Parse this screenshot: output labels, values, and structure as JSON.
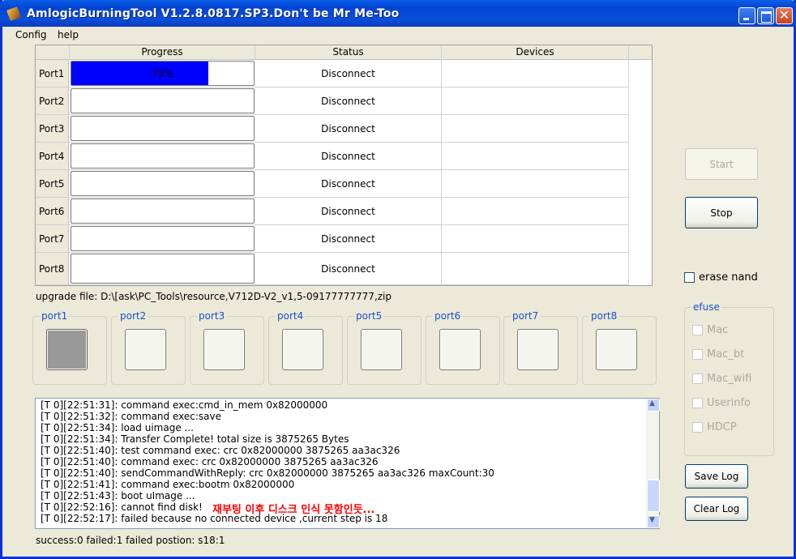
{
  "window": {
    "title": "AmlogicBurningTool  V1.2.8.0817.SP3.Don't be Mr Me-Too",
    "close_glyph": "✕"
  },
  "menu": [
    "Config",
    "help"
  ],
  "grid": {
    "headers": [
      "Progress",
      "Status",
      "Devices"
    ],
    "rows": [
      {
        "port": "Port1",
        "progress": 0.75,
        "progress_label": "75%",
        "status": "Disconnect",
        "device": ""
      },
      {
        "port": "Port2",
        "progress": 0,
        "progress_label": "",
        "status": "Disconnect",
        "device": ""
      },
      {
        "port": "Port3",
        "progress": 0,
        "progress_label": "",
        "status": "Disconnect",
        "device": ""
      },
      {
        "port": "Port4",
        "progress": 0,
        "progress_label": "",
        "status": "Disconnect",
        "device": ""
      },
      {
        "port": "Port5",
        "progress": 0,
        "progress_label": "",
        "status": "Disconnect",
        "device": ""
      },
      {
        "port": "Port6",
        "progress": 0,
        "progress_label": "",
        "status": "Disconnect",
        "device": ""
      },
      {
        "port": "Port7",
        "progress": 0,
        "progress_label": "",
        "status": "Disconnect",
        "device": ""
      },
      {
        "port": "Port8",
        "progress": 0,
        "progress_label": "",
        "status": "Disconnect",
        "device": ""
      }
    ]
  },
  "upgrade_file": "upgrade file: D:\\[ask\\PC_Tools\\resource,V712D-V2_v1,5-09177777777,zip",
  "port_indicators": [
    {
      "label": "port1",
      "active": true
    },
    {
      "label": "port2",
      "active": false
    },
    {
      "label": "port3",
      "active": false
    },
    {
      "label": "port4",
      "active": false
    },
    {
      "label": "port5",
      "active": false
    },
    {
      "label": "port6",
      "active": false
    },
    {
      "label": "port7",
      "active": false
    },
    {
      "label": "port8",
      "active": false
    }
  ],
  "log": {
    "lines": [
      "[T 0][22:51:31]: command exec:cmd_in_mem 0x82000000",
      "[T 0][22:51:32]: command exec:save",
      "[T 0][22:51:34]: load uimage ...",
      "[T 0][22:51:34]: Transfer Complete! total size is 3875265 Bytes",
      "[T 0][22:51:40]: test command exec: crc 0x82000000 3875265 aa3ac326",
      "[T 0][22:51:40]: command exec: crc 0x82000000 3875265 aa3ac326",
      "[T 0][22:51:40]: sendCommandWithReply: crc 0x82000000 3875265 aa3ac326 maxCount:30",
      "[T 0][22:51:41]: command exec:bootm 0x82000000",
      "[T 0][22:51:43]: boot uImage ...",
      "[T 0][22:52:16]: cannot find disk!",
      "[T 0][22:52:17]: failed because no connected device ,current step is 18"
    ],
    "note": "재부팅 이후 디스크 인식 못함인듯..."
  },
  "status_line": "success:0 failed:1 failed postion:   s18:1",
  "buttons": {
    "start": "Start",
    "stop": "Stop",
    "save_log": "Save Log",
    "clear_log": "Clear Log"
  },
  "erase_nand_label": "erase nand",
  "efuse": {
    "title": "efuse",
    "items": [
      "Mac",
      "Mac_bt",
      "Mac_wifi",
      "Userinfo",
      "HDCP"
    ]
  }
}
